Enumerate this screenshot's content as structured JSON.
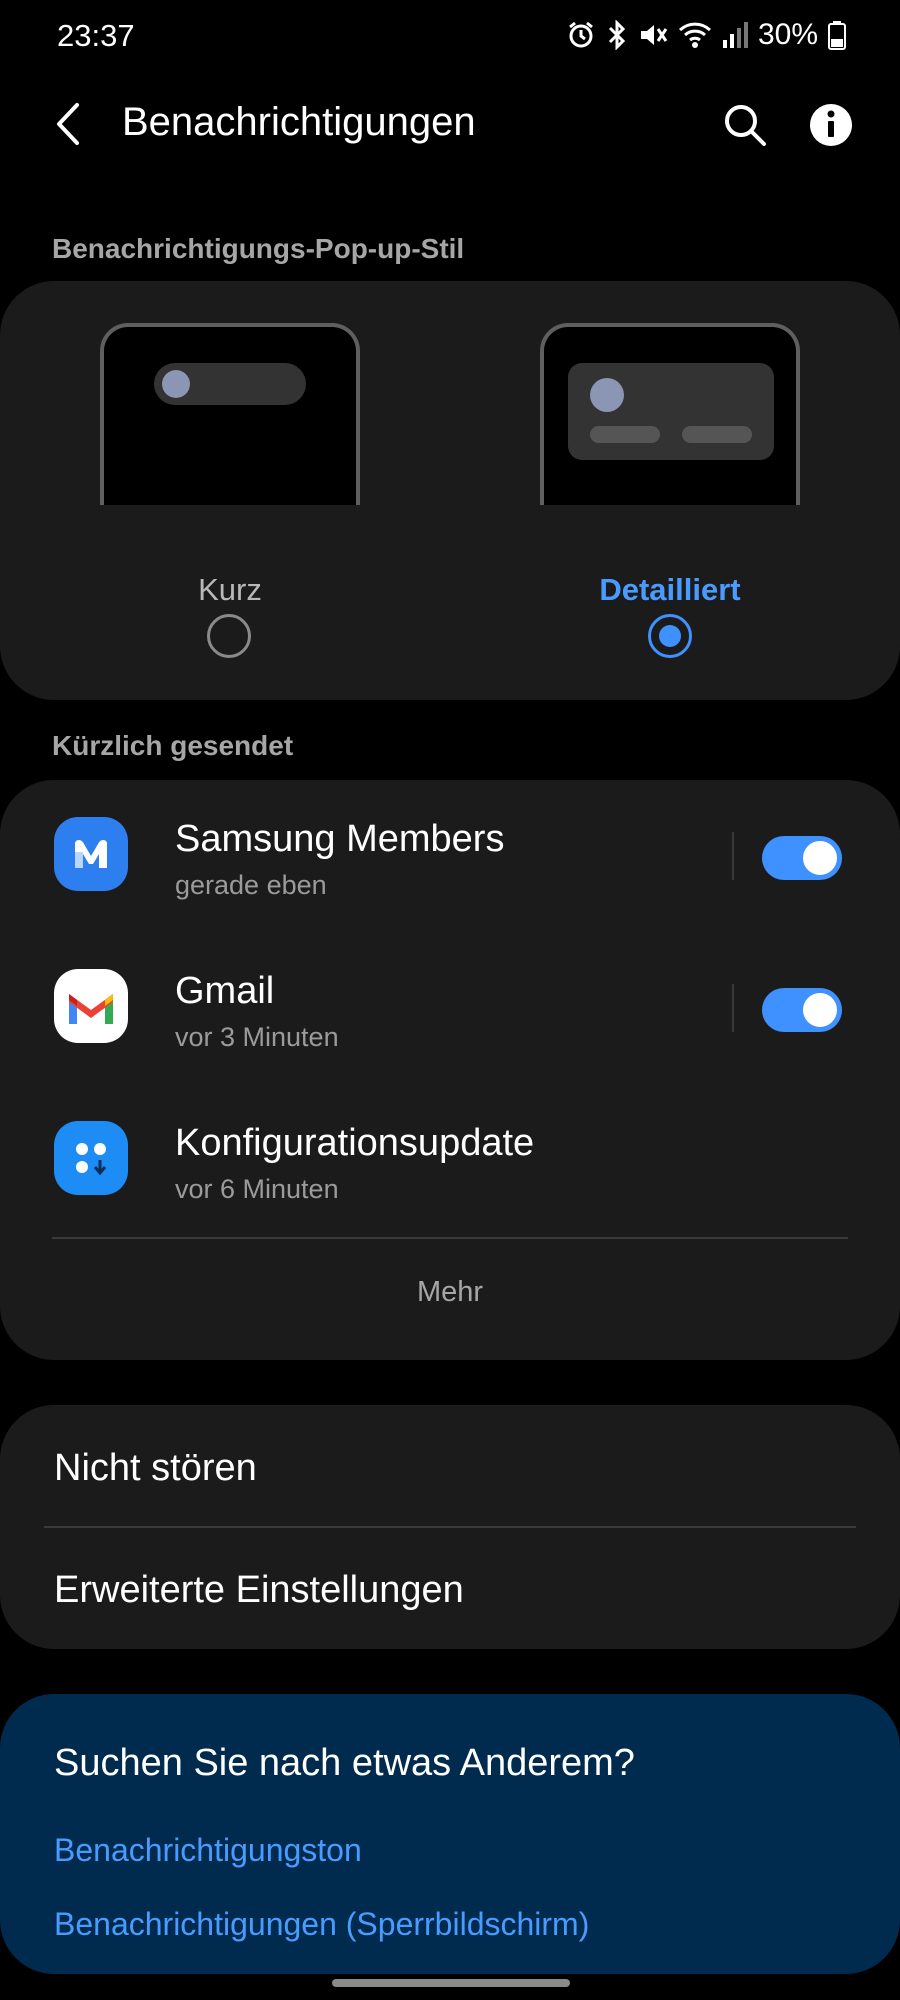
{
  "status_bar": {
    "time": "23:37",
    "battery": "30%",
    "icons": [
      "alarm-icon",
      "bluetooth-icon",
      "mute-icon",
      "wifi-icon",
      "signal-icon",
      "battery-icon"
    ]
  },
  "header": {
    "title": "Benachrichtigungen",
    "icons": [
      "back-icon",
      "search-icon",
      "info-icon"
    ]
  },
  "popup_style": {
    "section_label": "Benachrichtigungs-Pop-up-Stil",
    "options": [
      {
        "label": "Kurz",
        "selected": false
      },
      {
        "label": "Detailliert",
        "selected": true
      }
    ]
  },
  "recent": {
    "section_label": "Kürzlich gesendet",
    "apps": [
      {
        "name": "Samsung Members",
        "time": "gerade eben",
        "toggle": true,
        "icon": "samsung-members-icon"
      },
      {
        "name": "Gmail",
        "time": "vor 3 Minuten",
        "toggle": true,
        "icon": "gmail-icon"
      },
      {
        "name": "Konfigurationsupdate",
        "time": "vor 6 Minuten",
        "icon": "config-update-icon"
      }
    ],
    "more_label": "Mehr"
  },
  "menu": {
    "items": [
      "Nicht stören",
      "Erweiterte Einstellungen"
    ]
  },
  "suggestions": {
    "title": "Suchen Sie nach etwas Anderem?",
    "links": [
      "Benachrichtigungston",
      "Benachrichtigungen (Sperrbildschirm)"
    ]
  },
  "colors": {
    "accent": "#3e91ff",
    "card": "#1b1b1b",
    "suggest_card": "#002b4e",
    "link": "#4a9bff"
  }
}
